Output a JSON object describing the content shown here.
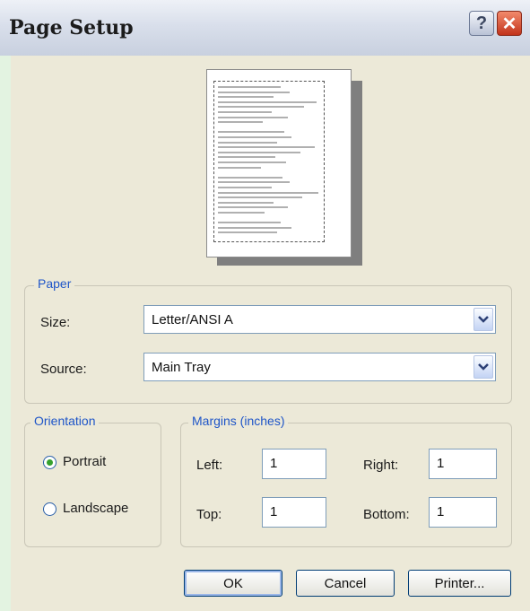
{
  "window": {
    "title": "Page Setup",
    "help_glyph": "?",
    "close_glyph": "✕"
  },
  "paper": {
    "group_label": "Paper",
    "size_label": "Size:",
    "size_value": "Letter/ANSI A",
    "source_label": "Source:",
    "source_value": "Main Tray"
  },
  "orientation": {
    "group_label": "Orientation",
    "options": [
      "Portrait",
      "Landscape"
    ],
    "selected": "Portrait"
  },
  "margins": {
    "group_label": "Margins (inches)",
    "left_label": "Left:",
    "left_value": "1",
    "right_label": "Right:",
    "right_value": "1",
    "top_label": "Top:",
    "top_value": "1",
    "bottom_label": "Bottom:",
    "bottom_value": "1"
  },
  "buttons": {
    "ok": "OK",
    "cancel": "Cancel",
    "printer": "Printer..."
  },
  "icons": {
    "help": "help-icon",
    "close": "close-icon",
    "dropdown": "chevron-down-icon"
  },
  "colors": {
    "group_label": "#1e55c8",
    "dialog_bg": "#ece9d8",
    "close_button": "#c2331b",
    "radio_dot": "#36a12e"
  }
}
